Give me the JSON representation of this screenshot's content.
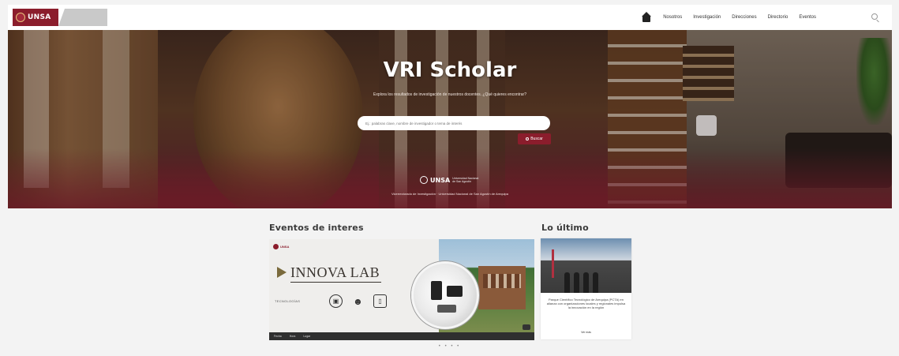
{
  "header": {
    "logo_text": "UNSA",
    "logo_subtext": "",
    "nav_items": [
      "Nosotros",
      "Investigación",
      "Direcciones",
      "Directorio",
      "Eventos"
    ]
  },
  "hero": {
    "title": "VRI Scholar",
    "subtitle": "Explora los resultados de investigación de nuestros docentes. ¿Qué quieres encontrar?",
    "search_placeholder": "Ej.: palabras clave, nombre de investigador o tema de interés",
    "search_button": "Buscar",
    "logo_text": "UNSA",
    "logo_subtext": "Universidad Nacional de San Agustín",
    "caption": "Vicerrectorado de Investigación · Universidad Nacional de San Agustín de Arequipa"
  },
  "events": {
    "heading": "Eventos de interes",
    "card": {
      "logo_text": "UNSA",
      "title": "INNOVA LAB",
      "tech_label": "TECNOLOGÍAS",
      "footer_items": [
        "Fecha",
        "Hora",
        "Lugar"
      ]
    },
    "carousel_dots": "• • • •"
  },
  "latest": {
    "heading": "Lo último",
    "card_text": "Parque Científico Tecnológico de Arequipa (PCTA) en alianza con organizaciones locales y regionales impulsa la innovación en la región",
    "more_label": "Ver más"
  }
}
